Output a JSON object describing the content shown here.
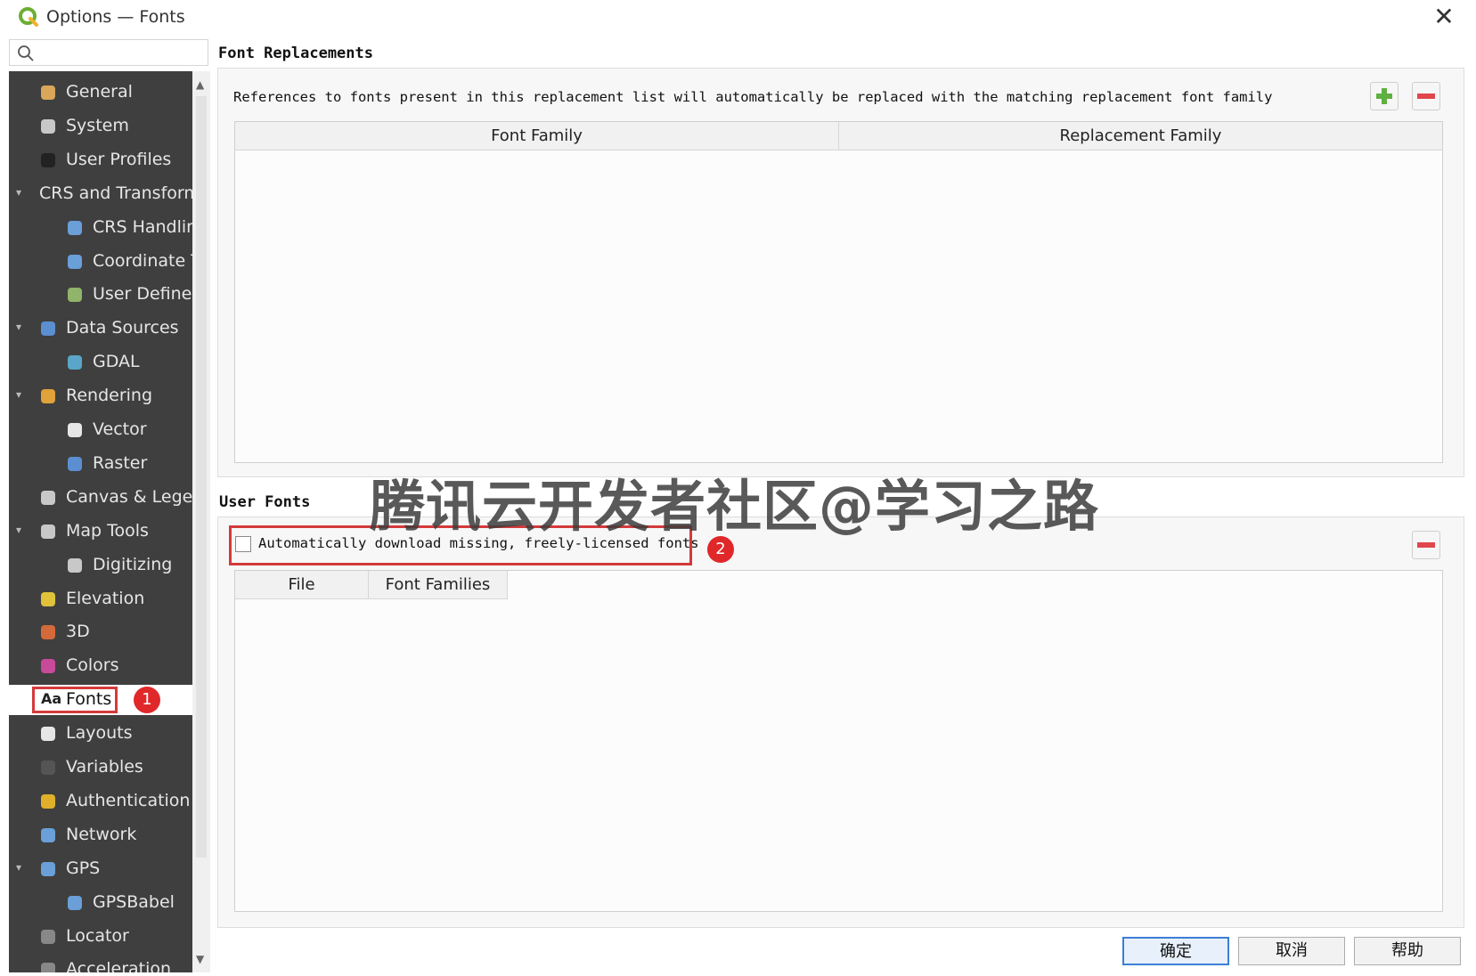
{
  "window": {
    "title": "Options — Fonts",
    "close_glyph": "✕"
  },
  "search": {
    "placeholder": ""
  },
  "sidebar": {
    "items": [
      {
        "label": "General",
        "icon": "general-icon",
        "color": "#d9a65a"
      },
      {
        "label": "System",
        "icon": "system-icon",
        "color": "#c8c8c8"
      },
      {
        "label": "User Profiles",
        "icon": "user-profiles-icon",
        "color": "#222222"
      },
      {
        "label": "CRS and Transform",
        "icon": "",
        "color": ""
      },
      {
        "label": "CRS Handling",
        "icon": "crs-handling-icon",
        "color": "#6a9fd8"
      },
      {
        "label": "Coordinate Transforms",
        "icon": "coordinate-transforms-icon",
        "color": "#6a9fd8"
      },
      {
        "label": "User Defined CRS",
        "icon": "user-defined-crs-icon",
        "color": "#8fb46a"
      },
      {
        "label": "Data Sources",
        "icon": "data-sources-icon",
        "color": "#5b8fd1"
      },
      {
        "label": "GDAL",
        "icon": "gdal-icon",
        "color": "#5aa6c9"
      },
      {
        "label": "Rendering",
        "icon": "rendering-icon",
        "color": "#e0a23a"
      },
      {
        "label": "Vector",
        "icon": "vector-icon",
        "color": "#e6e6e6"
      },
      {
        "label": "Raster",
        "icon": "raster-icon",
        "color": "#5b8fd1"
      },
      {
        "label": "Canvas & Legend",
        "icon": "canvas-legend-icon",
        "color": "#c8c8c8"
      },
      {
        "label": "Map Tools",
        "icon": "map-tools-icon",
        "color": "#c8c8c8"
      },
      {
        "label": "Digitizing",
        "icon": "digitizing-icon",
        "color": "#c8c8c8"
      },
      {
        "label": "Elevation",
        "icon": "elevation-icon",
        "color": "#e0c23a"
      },
      {
        "label": "3D",
        "icon": "3d-icon",
        "color": "#d46a3a"
      },
      {
        "label": "Colors",
        "icon": "colors-icon",
        "color": "#c84a9a"
      },
      {
        "label": "Fonts",
        "icon": "fonts-icon",
        "color": "#222222"
      },
      {
        "label": "Layouts",
        "icon": "layouts-icon",
        "color": "#e6e6e6"
      },
      {
        "label": "Variables",
        "icon": "variables-icon",
        "color": "#555555"
      },
      {
        "label": "Authentication",
        "icon": "authentication-icon",
        "color": "#e0b02a"
      },
      {
        "label": "Network",
        "icon": "network-icon",
        "color": "#6a9fd8"
      },
      {
        "label": "GPS",
        "icon": "gps-icon",
        "color": "#6a9fd8"
      },
      {
        "label": "GPSBabel",
        "icon": "gpsbabel-icon",
        "color": "#6a9fd8"
      },
      {
        "label": "Locator",
        "icon": "locator-icon",
        "color": "#888888"
      },
      {
        "label": "Acceleration",
        "icon": "acceleration-icon",
        "color": "#888888"
      }
    ],
    "selected": "Fonts"
  },
  "font_replacements": {
    "title": "Font Replacements",
    "description": "References to fonts present in this replacement list will automatically be replaced with the matching replacement font family",
    "columns": [
      "Font Family",
      "Replacement Family"
    ],
    "rows": []
  },
  "user_fonts": {
    "title": "User Fonts",
    "auto_download_label": "Automatically download missing, freely-licensed fonts",
    "auto_download_checked": false,
    "columns": [
      "File",
      "Font Families"
    ],
    "rows": []
  },
  "annotations": {
    "badge_1": "1",
    "badge_2": "2",
    "highlight_color": "#d43a3a"
  },
  "footer": {
    "ok": "确定",
    "cancel": "取消",
    "help": "帮助"
  },
  "watermark": "腾讯云开发者社区@学习之路"
}
